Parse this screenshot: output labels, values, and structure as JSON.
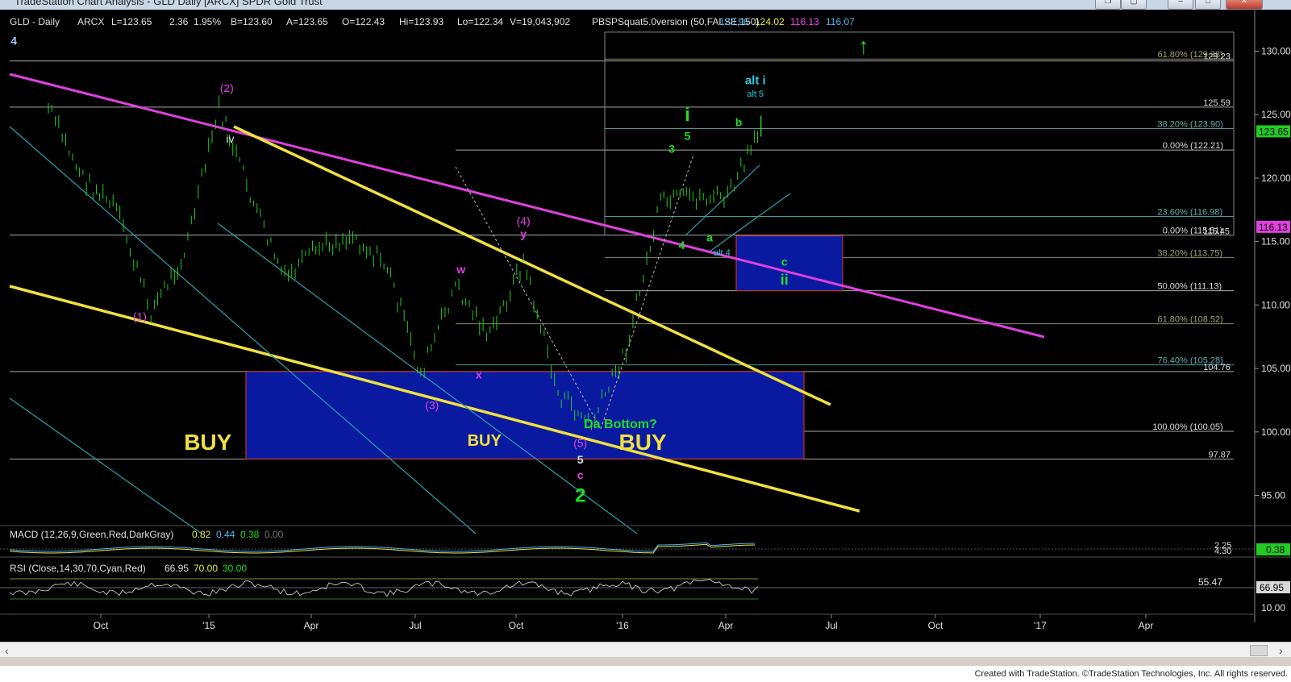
{
  "window": {
    "title": "TradeStation Chart Analysis - GLD Daily [ARCX] SPDR Gold Trust"
  },
  "header": {
    "symbol": "GLD - Daily",
    "exchange": "ARCX",
    "last": "L=123.65",
    "change": "2.36",
    "pct_change": "1.95%",
    "bid": "B=123.60",
    "ask": "A=123.65",
    "open": "O=122.43",
    "high": "Hi=123.93",
    "low": "Lo=122.34",
    "volume": "V=19,043,902",
    "study": "PBSPSquat5.0version (50,FALSE,150)",
    "study_values": [
      {
        "v": "123.96",
        "color": "#4fb5e8"
      },
      {
        "v": "124.02",
        "color": "#e8e84f"
      },
      {
        "v": "116.13",
        "color": "#ff40ff"
      },
      {
        "v": "116.07",
        "color": "#4fb5e8"
      }
    ]
  },
  "colors": {
    "background": "#000000",
    "price_bars": "#22cc22",
    "magenta": "#e040e0",
    "yellow": "#f0e040",
    "cyan": "#2aa0b0",
    "green_label": "#22dd22",
    "buy_box": "#0a1aa0",
    "buy_text": "#f0e040"
  },
  "chart_data": [
    {
      "type": "line",
      "title": "GLD - Daily ARCX",
      "y_axis": {
        "ylim": [
          93,
          132
        ],
        "ticks": [
          95,
          100,
          105,
          110,
          115,
          120,
          125,
          130
        ],
        "tick_labels": [
          "95.00",
          "100.00",
          "105.00",
          "110.00",
          "115.00",
          "120.00",
          "125.00",
          "130.00"
        ]
      },
      "x_axis": {
        "labels": [
          "Oct",
          "'15",
          "Apr",
          "Jul",
          "Oct",
          "'16",
          "Apr",
          "Jul",
          "Oct",
          "'17",
          "Apr"
        ]
      },
      "series": [
        {
          "style": "price_bars",
          "x": [
            "2014-08",
            "2014-09",
            "2014-10",
            "2014-11",
            "2014-12",
            "2015-01",
            "2015-02",
            "2015-03",
            "2015-04",
            "2015-05",
            "2015-06",
            "2015-07",
            "2015-08",
            "2015-09",
            "2015-10",
            "2015-11",
            "2015-12",
            "2016-01",
            "2016-02",
            "2016-03",
            "2016-04",
            "2016-05"
          ],
          "values": [
            125.5,
            120.0,
            117.5,
            109.5,
            114.0,
            125.5,
            118.0,
            112.0,
            114.5,
            115.5,
            113.0,
            104.5,
            111.5,
            107.5,
            113.5,
            103.0,
            100.5,
            106.5,
            118.0,
            118.5,
            118.5,
            123.65
          ]
        }
      ],
      "price_tag": {
        "value": 123.65,
        "label": "123.65"
      },
      "ma_tag": {
        "value": 116.13,
        "label": "116.13"
      },
      "fib_levels": [
        {
          "label": "61.80% (129.38)",
          "value": 129.38
        },
        {
          "label": "129.23",
          "value": 129.23
        },
        {
          "label": "125.59",
          "value": 125.59
        },
        {
          "label": "38.20% (123.90)",
          "value": 123.9
        },
        {
          "label": "0.00% (122.21)",
          "value": 122.21
        },
        {
          "label": "23.60% (116.98)",
          "value": 116.98
        },
        {
          "label": "0.00% (115.51)",
          "value": 115.51
        },
        {
          "label": "115.45",
          "value": 115.45
        },
        {
          "label": "38.20% (113.75)",
          "value": 113.75
        },
        {
          "label": "50.00% (111.13)",
          "value": 111.13
        },
        {
          "label": "61.80% (108.52)",
          "value": 108.52
        },
        {
          "label": "76.40% (105.28)",
          "value": 105.28
        },
        {
          "label": "104.76",
          "value": 104.76
        },
        {
          "label": "100.00% (100.05)",
          "value": 100.05
        },
        {
          "label": "97.87",
          "value": 97.87
        }
      ],
      "wave_labels": [
        {
          "text": "4",
          "color": "#9fc8ff",
          "x": "2014-07",
          "y": 130.5
        },
        {
          "text": "(2)",
          "color": "#e040e0",
          "x": "2015-01-22",
          "y": 126.8
        },
        {
          "text": "iv",
          "color": "#e0e0e0",
          "x": "2015-01-25",
          "y": 122.8
        },
        {
          "text": "(1)",
          "color": "#e040e0",
          "x": "2014-11-05",
          "y": 108.8
        },
        {
          "text": "w",
          "color": "#e040e0",
          "x": "2015-08-20",
          "y": 112.5
        },
        {
          "text": "x",
          "color": "#e040e0",
          "x": "2015-09-05",
          "y": 104.2
        },
        {
          "text": "(3)",
          "color": "#e040e0",
          "x": "2015-07-25",
          "y": 101.8
        },
        {
          "text": "(4)",
          "color": "#e040e0",
          "x": "2015-10-15",
          "y": 116.3
        },
        {
          "text": "y",
          "color": "#e040e0",
          "x": "2015-10-15",
          "y": 115.3
        },
        {
          "text": "(5)",
          "color": "#e040e0",
          "x": "2015-12-05",
          "y": 98.8
        },
        {
          "text": "5",
          "color": "#e0e0e0",
          "x": "2015-12-05",
          "y": 97.5
        },
        {
          "text": "c",
          "color": "#e040e0",
          "x": "2015-12-05",
          "y": 96.3
        },
        {
          "text": "2",
          "color": "#22dd22",
          "x": "2015-12-05",
          "y": 94.5
        },
        {
          "text": "Da Bottom?",
          "color": "#22dd22",
          "x": "2016-01-10",
          "y": 100.3
        },
        {
          "text": "3",
          "color": "#22dd22",
          "x": "2016-02-25",
          "y": 122.0
        },
        {
          "text": "i",
          "color": "#22dd22",
          "x": "2016-03-10",
          "y": 124.5
        },
        {
          "text": "5",
          "color": "#22dd22",
          "x": "2016-03-10",
          "y": 123.0
        },
        {
          "text": "4",
          "color": "#22dd22",
          "x": "2016-03-05",
          "y": 114.4
        },
        {
          "text": "a",
          "color": "#22dd22",
          "x": "2016-03-30",
          "y": 115.0
        },
        {
          "text": "alt 4",
          "color": "#2ec8e0",
          "x": "2016-04-10",
          "y": 113.9
        },
        {
          "text": "b",
          "color": "#22dd22",
          "x": "2016-04-25",
          "y": 124.1
        },
        {
          "text": "alt i",
          "color": "#2ec8e0",
          "x": "2016-05-10",
          "y": 127.4
        },
        {
          "text": "alt 5",
          "color": "#2ec8e0",
          "x": "2016-05-10",
          "y": 126.4
        },
        {
          "text": "c",
          "color": "#22dd22",
          "x": "2016-06-05",
          "y": 113.1
        },
        {
          "text": "ii",
          "color": "#22dd22",
          "x": "2016-06-05",
          "y": 111.6
        },
        {
          "text": "BUY",
          "color": "#f0e040",
          "x": "2015-01-05",
          "y": 98.6
        },
        {
          "text": "BUY",
          "color": "#f0e040",
          "x": "2015-09-10",
          "y": 98.9
        },
        {
          "text": "BUY",
          "color": "#f0e040",
          "x": "2016-01-30",
          "y": 98.6
        },
        {
          "text": "↑",
          "color": "#22dd22",
          "x": "2016-08-15",
          "y": 129.8
        }
      ]
    },
    {
      "type": "line",
      "title": "MACD (12,26,9,Green,Red,DarkGray)",
      "values_text": [
        {
          "v": "0.82",
          "color": "#e8e84f"
        },
        {
          "v": "0.44",
          "color": "#4fb5e8"
        },
        {
          "v": "0.38",
          "color": "#22dd22"
        },
        {
          "v": "0.00",
          "color": "#777777"
        }
      ],
      "right_labels": [
        "2.25",
        "4.30"
      ],
      "tag": "0.38"
    },
    {
      "type": "line",
      "title": "RSI (Close,14,30,70,Cyan,Red)",
      "values_text": [
        {
          "v": "66.95",
          "color": "#e0e0e0"
        },
        {
          "v": "70.00",
          "color": "#e8e84f"
        },
        {
          "v": "30.00",
          "color": "#22dd22"
        }
      ],
      "right_labels": [
        "55.47",
        "10.00"
      ],
      "tag": "66.95"
    }
  ],
  "footer": {
    "text": "Created with TradeStation. ©TradeStation Technologies, Inc. All rights reserved."
  }
}
